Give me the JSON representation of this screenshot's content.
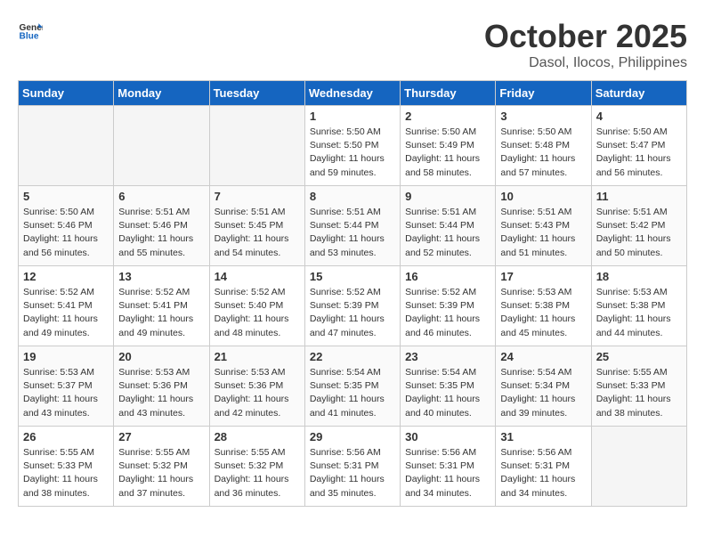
{
  "header": {
    "logo_line1": "General",
    "logo_line2": "Blue",
    "month_title": "October 2025",
    "location": "Dasol, Ilocos, Philippines"
  },
  "weekdays": [
    "Sunday",
    "Monday",
    "Tuesday",
    "Wednesday",
    "Thursday",
    "Friday",
    "Saturday"
  ],
  "weeks": [
    [
      {
        "day": "",
        "empty": true
      },
      {
        "day": "",
        "empty": true
      },
      {
        "day": "",
        "empty": true
      },
      {
        "day": "1",
        "sunrise": "5:50 AM",
        "sunset": "5:50 PM",
        "daylight": "11 hours and 59 minutes."
      },
      {
        "day": "2",
        "sunrise": "5:50 AM",
        "sunset": "5:49 PM",
        "daylight": "11 hours and 58 minutes."
      },
      {
        "day": "3",
        "sunrise": "5:50 AM",
        "sunset": "5:48 PM",
        "daylight": "11 hours and 57 minutes."
      },
      {
        "day": "4",
        "sunrise": "5:50 AM",
        "sunset": "5:47 PM",
        "daylight": "11 hours and 56 minutes."
      }
    ],
    [
      {
        "day": "5",
        "sunrise": "5:50 AM",
        "sunset": "5:46 PM",
        "daylight": "11 hours and 56 minutes."
      },
      {
        "day": "6",
        "sunrise": "5:51 AM",
        "sunset": "5:46 PM",
        "daylight": "11 hours and 55 minutes."
      },
      {
        "day": "7",
        "sunrise": "5:51 AM",
        "sunset": "5:45 PM",
        "daylight": "11 hours and 54 minutes."
      },
      {
        "day": "8",
        "sunrise": "5:51 AM",
        "sunset": "5:44 PM",
        "daylight": "11 hours and 53 minutes."
      },
      {
        "day": "9",
        "sunrise": "5:51 AM",
        "sunset": "5:44 PM",
        "daylight": "11 hours and 52 minutes."
      },
      {
        "day": "10",
        "sunrise": "5:51 AM",
        "sunset": "5:43 PM",
        "daylight": "11 hours and 51 minutes."
      },
      {
        "day": "11",
        "sunrise": "5:51 AM",
        "sunset": "5:42 PM",
        "daylight": "11 hours and 50 minutes."
      }
    ],
    [
      {
        "day": "12",
        "sunrise": "5:52 AM",
        "sunset": "5:41 PM",
        "daylight": "11 hours and 49 minutes."
      },
      {
        "day": "13",
        "sunrise": "5:52 AM",
        "sunset": "5:41 PM",
        "daylight": "11 hours and 49 minutes."
      },
      {
        "day": "14",
        "sunrise": "5:52 AM",
        "sunset": "5:40 PM",
        "daylight": "11 hours and 48 minutes."
      },
      {
        "day": "15",
        "sunrise": "5:52 AM",
        "sunset": "5:39 PM",
        "daylight": "11 hours and 47 minutes."
      },
      {
        "day": "16",
        "sunrise": "5:52 AM",
        "sunset": "5:39 PM",
        "daylight": "11 hours and 46 minutes."
      },
      {
        "day": "17",
        "sunrise": "5:53 AM",
        "sunset": "5:38 PM",
        "daylight": "11 hours and 45 minutes."
      },
      {
        "day": "18",
        "sunrise": "5:53 AM",
        "sunset": "5:38 PM",
        "daylight": "11 hours and 44 minutes."
      }
    ],
    [
      {
        "day": "19",
        "sunrise": "5:53 AM",
        "sunset": "5:37 PM",
        "daylight": "11 hours and 43 minutes."
      },
      {
        "day": "20",
        "sunrise": "5:53 AM",
        "sunset": "5:36 PM",
        "daylight": "11 hours and 43 minutes."
      },
      {
        "day": "21",
        "sunrise": "5:53 AM",
        "sunset": "5:36 PM",
        "daylight": "11 hours and 42 minutes."
      },
      {
        "day": "22",
        "sunrise": "5:54 AM",
        "sunset": "5:35 PM",
        "daylight": "11 hours and 41 minutes."
      },
      {
        "day": "23",
        "sunrise": "5:54 AM",
        "sunset": "5:35 PM",
        "daylight": "11 hours and 40 minutes."
      },
      {
        "day": "24",
        "sunrise": "5:54 AM",
        "sunset": "5:34 PM",
        "daylight": "11 hours and 39 minutes."
      },
      {
        "day": "25",
        "sunrise": "5:55 AM",
        "sunset": "5:33 PM",
        "daylight": "11 hours and 38 minutes."
      }
    ],
    [
      {
        "day": "26",
        "sunrise": "5:55 AM",
        "sunset": "5:33 PM",
        "daylight": "11 hours and 38 minutes."
      },
      {
        "day": "27",
        "sunrise": "5:55 AM",
        "sunset": "5:32 PM",
        "daylight": "11 hours and 37 minutes."
      },
      {
        "day": "28",
        "sunrise": "5:55 AM",
        "sunset": "5:32 PM",
        "daylight": "11 hours and 36 minutes."
      },
      {
        "day": "29",
        "sunrise": "5:56 AM",
        "sunset": "5:31 PM",
        "daylight": "11 hours and 35 minutes."
      },
      {
        "day": "30",
        "sunrise": "5:56 AM",
        "sunset": "5:31 PM",
        "daylight": "11 hours and 34 minutes."
      },
      {
        "day": "31",
        "sunrise": "5:56 AM",
        "sunset": "5:31 PM",
        "daylight": "11 hours and 34 minutes."
      },
      {
        "day": "",
        "empty": true
      }
    ]
  ],
  "labels": {
    "sunrise": "Sunrise:",
    "sunset": "Sunset:",
    "daylight": "Daylight:"
  }
}
